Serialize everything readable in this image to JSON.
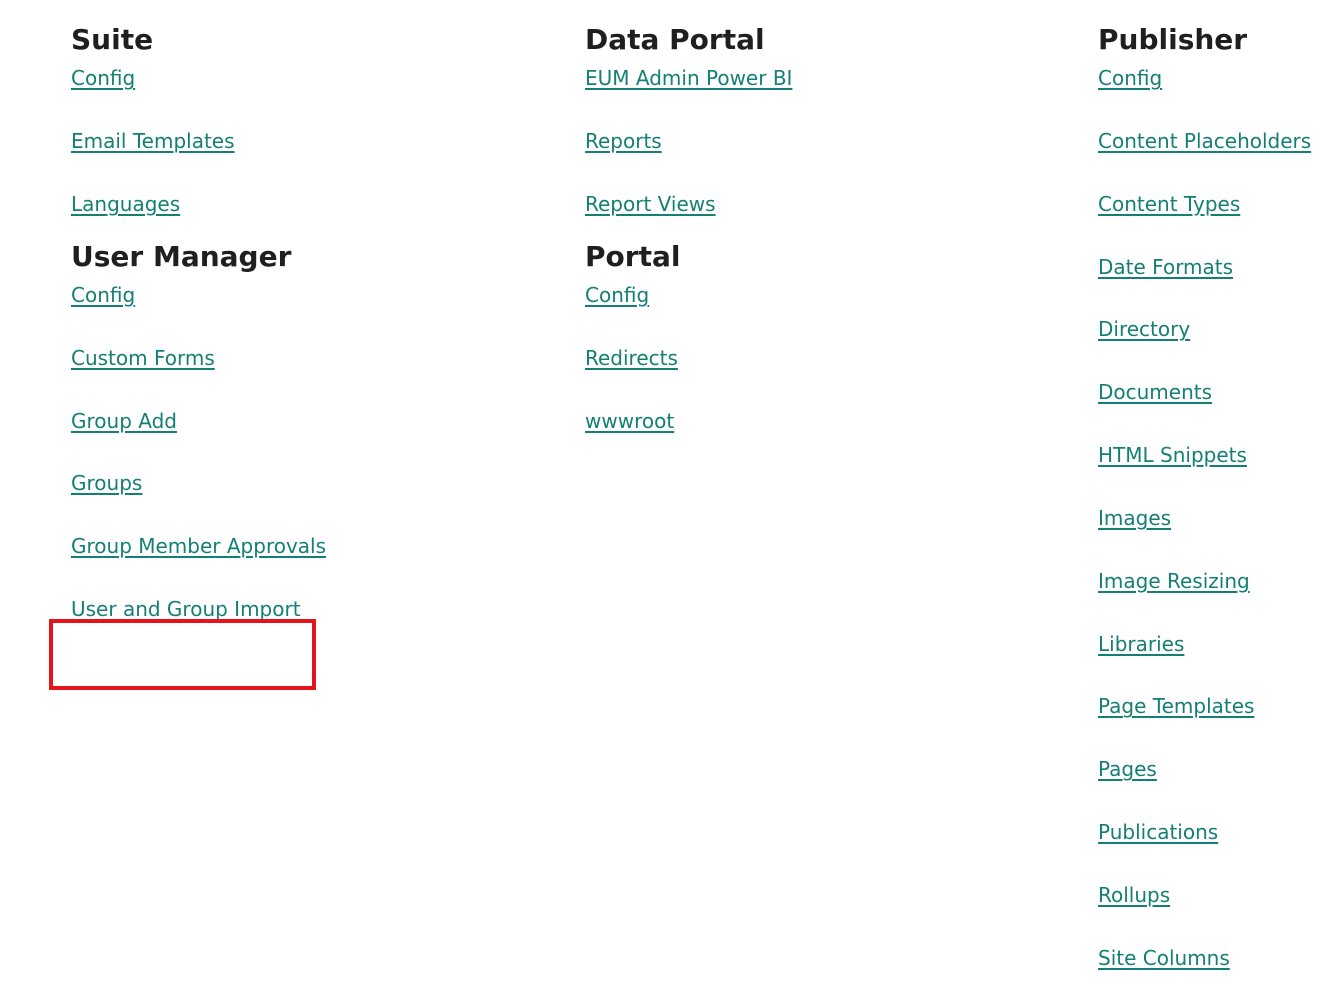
{
  "sections": {
    "suite": {
      "title": "Suite",
      "links": [
        "Config",
        "Email Templates",
        "Languages"
      ]
    },
    "user_manager": {
      "title": "User Manager",
      "links": [
        "Config",
        "Custom Forms",
        "Group Add",
        "Groups",
        "Group Member Approvals",
        "User and Group Import"
      ]
    },
    "data_portal": {
      "title": "Data Portal",
      "links": [
        "EUM Admin Power BI",
        "Reports",
        "Report Views"
      ]
    },
    "portal": {
      "title": "Portal",
      "links": [
        "Config",
        "Redirects",
        "wwwroot"
      ]
    },
    "publisher": {
      "title": "Publisher",
      "links": [
        "Config",
        "Content Placeholders",
        "Content Types",
        "Date Formats",
        "Directory",
        "Documents",
        "HTML Snippets",
        "Images",
        "Image Resizing",
        "Libraries",
        "Page Templates",
        "Pages",
        "Publications",
        "Rollups",
        "Site Columns"
      ]
    }
  },
  "highlight": {
    "target": "User and Group Import",
    "color": "#e3141b"
  },
  "colors": {
    "link": "#147f74",
    "heading": "#1f1f1f",
    "background": "#ffffff"
  }
}
